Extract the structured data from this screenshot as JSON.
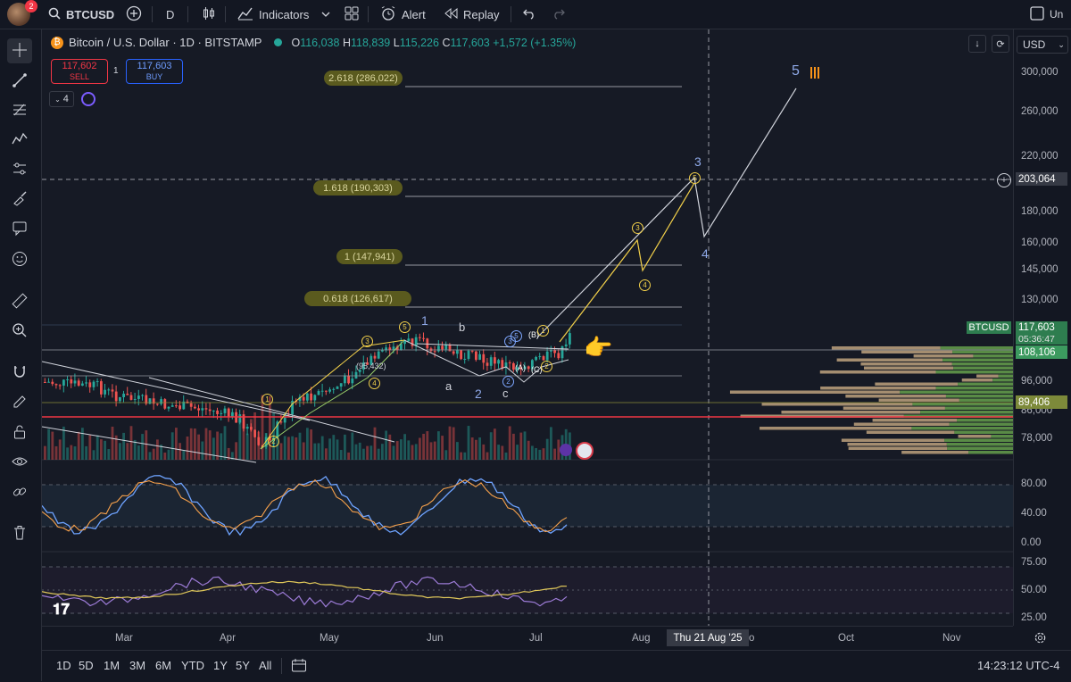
{
  "toolbar": {
    "avatar_badge": "2",
    "symbol": "BTCUSD",
    "interval": "D",
    "indicators_label": "Indicators",
    "alert_label": "Alert",
    "replay_label": "Replay",
    "right_label": "Un"
  },
  "legend": {
    "title": "Bitcoin / U.S. Dollar · 1D · BITSTAMP",
    "o_label": "O",
    "o_value": "116,038",
    "h_label": "H",
    "h_value": "118,839",
    "l_label": "L",
    "l_value": "115,226",
    "c_label": "C",
    "c_value": "117,603",
    "change": "+1,572 (+1.35%)",
    "sell_price": "117,602",
    "sell_label": "SELL",
    "spread": "1",
    "buy_price": "117,603",
    "buy_label": "BUY",
    "indicators_count": "4",
    "currency": "USD"
  },
  "fib_levels": {
    "f2618": "2.618 (286,022)",
    "f1618": "1.618 (190,303)",
    "f1": "1 (147,941)",
    "f0618": "0.618 (126,617)"
  },
  "waves": {
    "w1": "1",
    "w2": "2",
    "w3": "3",
    "w4": "4",
    "w5": "5",
    "a": "a",
    "b": "b",
    "c": "c",
    "A": "(A)",
    "B": "(B)",
    "C": "(C)",
    "sub1": "1",
    "sub2": "2",
    "sub3": "3",
    "sub4": "4",
    "sub5": "5",
    "sub_label": "(95,432)"
  },
  "price_axis": {
    "labels": [
      "300,000",
      "260,000",
      "220,000",
      "180,000",
      "160,000",
      "145,000",
      "130,000",
      "96,000",
      "86,000",
      "78,000"
    ],
    "crosshair": "203,064",
    "btc_tag": "BTCUSD",
    "btc_price": "117,603",
    "countdown": "05:36:47",
    "green_level": "108,106",
    "yellow_level": "89,406",
    "osc_labels": [
      "80.00",
      "40.00",
      "0.00"
    ],
    "rsi_labels": [
      "75.00",
      "50.00",
      "25.00"
    ]
  },
  "time_axis": {
    "labels": [
      "Mar",
      "Apr",
      "May",
      "Jun",
      "Jul",
      "Aug",
      "Oct",
      "Nov"
    ],
    "crosshair_date": "Thu 21 Aug '25",
    "partial_label": "o"
  },
  "bottom": {
    "ranges": [
      "1D",
      "5D",
      "1M",
      "3M",
      "6M",
      "YTD",
      "1Y",
      "5Y",
      "All"
    ],
    "clock": "14:23:12 UTC-4"
  },
  "colors": {
    "up": "#26a69a",
    "down": "#ef5350",
    "fib_text": "#d8d49c",
    "wave_blue": "#8fa9e8",
    "wave_yellow": "#f2d04a",
    "price_line_red": "#f23645"
  }
}
